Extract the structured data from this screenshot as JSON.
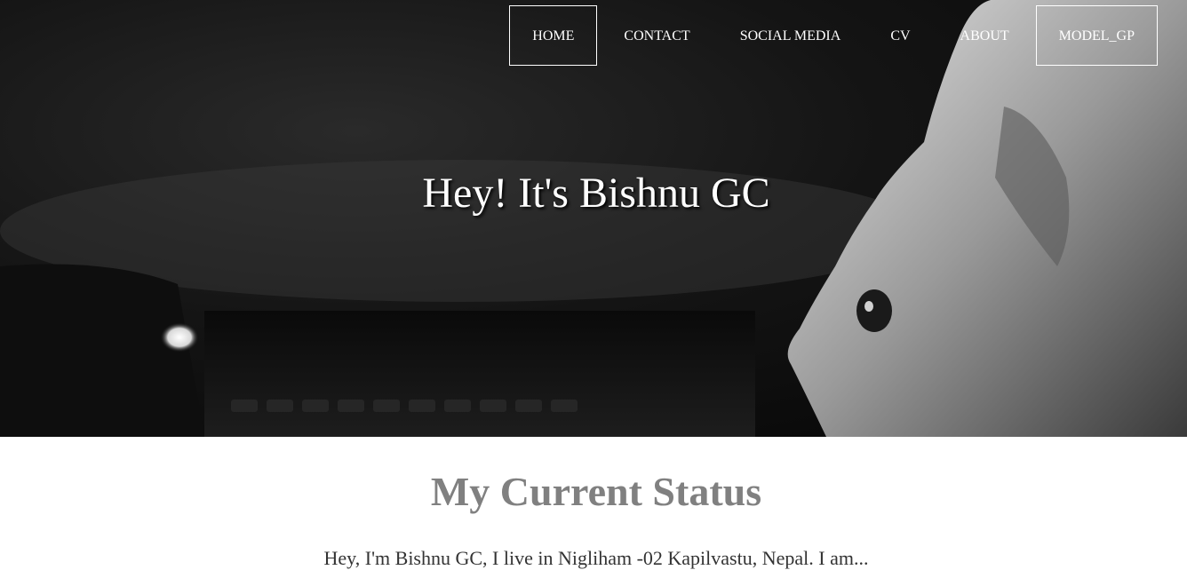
{
  "nav": {
    "items": [
      {
        "label": "HOME",
        "boxed": true
      },
      {
        "label": "CONTACT",
        "boxed": false
      },
      {
        "label": "SOCIAL MEDIA",
        "boxed": false
      },
      {
        "label": "CV",
        "boxed": false
      },
      {
        "label": "ABOUT",
        "boxed": false
      },
      {
        "label": "MODEL_GP",
        "boxed": true
      }
    ]
  },
  "hero": {
    "title": "Hey! It's Bishnu GC"
  },
  "status": {
    "title": "My Current Status",
    "text": "Hey, I'm Bishnu GC, I live in Nigliham -02 Kapilvastu, Nepal. I am..."
  }
}
